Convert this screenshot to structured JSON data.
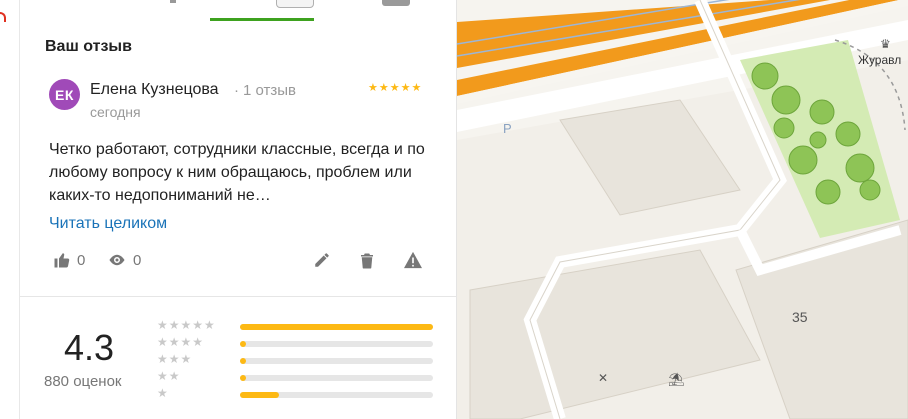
{
  "map": {
    "house_number": "35",
    "place_label": "Журавл",
    "parking_label": "P"
  },
  "review": {
    "section_title": "Ваш отзыв",
    "author": {
      "initials": "ЕК",
      "name": "Елена Кузнецова",
      "meta": "1 отзыв",
      "avatar_color": "#a04ab8"
    },
    "date": "сегодня",
    "stars": "★★★★★",
    "rating": 5,
    "text": "Четко работают, сотрудники классные, всегда и по любому вопросу к ним обращаюсь, проблем или каких-то недопониманий не…",
    "read_more": "Читать целиком",
    "likes": "0",
    "views": "0",
    "icons": [
      "thumbs-up-icon",
      "eye-icon",
      "pencil-icon",
      "trash-icon",
      "warning-icon"
    ]
  },
  "rating_summary": {
    "score": "4.3",
    "count_label": "880 оценок",
    "distribution": [
      {
        "stars": "★★★★★",
        "fraction": 1.0
      },
      {
        "stars": "★★★★",
        "fraction": 0.03
      },
      {
        "stars": "★★★",
        "fraction": 0.03
      },
      {
        "stars": "★★",
        "fraction": 0.03
      },
      {
        "stars": "★",
        "fraction": 0.2
      }
    ]
  },
  "colors": {
    "accent_green": "#3ea21f",
    "star_yellow": "#fdb914",
    "link_blue": "#1a73b8",
    "road_orange": "#f29a1c"
  }
}
